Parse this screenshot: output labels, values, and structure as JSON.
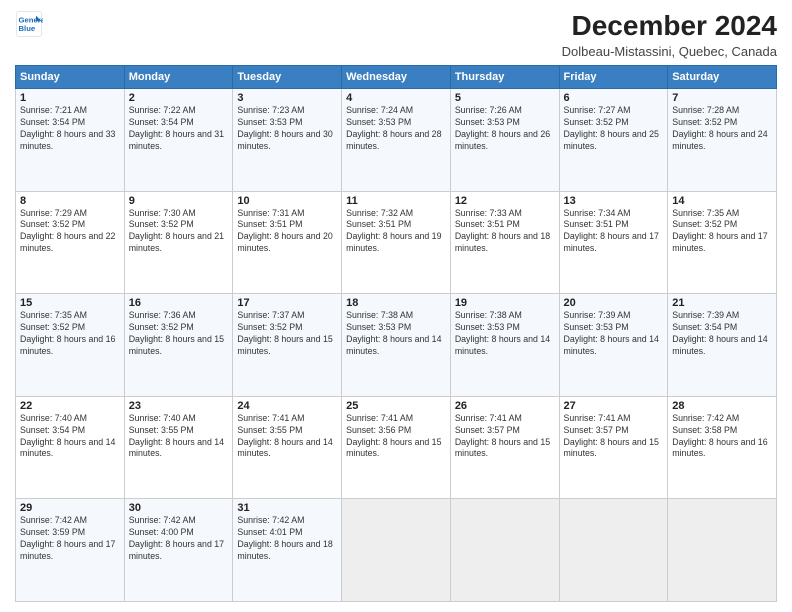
{
  "logo": {
    "line1": "General",
    "line2": "Blue"
  },
  "title": "December 2024",
  "subtitle": "Dolbeau-Mistassini, Quebec, Canada",
  "header_days": [
    "Sunday",
    "Monday",
    "Tuesday",
    "Wednesday",
    "Thursday",
    "Friday",
    "Saturday"
  ],
  "weeks": [
    [
      {
        "day": "1",
        "sunrise": "Sunrise: 7:21 AM",
        "sunset": "Sunset: 3:54 PM",
        "daylight": "Daylight: 8 hours and 33 minutes."
      },
      {
        "day": "2",
        "sunrise": "Sunrise: 7:22 AM",
        "sunset": "Sunset: 3:54 PM",
        "daylight": "Daylight: 8 hours and 31 minutes."
      },
      {
        "day": "3",
        "sunrise": "Sunrise: 7:23 AM",
        "sunset": "Sunset: 3:53 PM",
        "daylight": "Daylight: 8 hours and 30 minutes."
      },
      {
        "day": "4",
        "sunrise": "Sunrise: 7:24 AM",
        "sunset": "Sunset: 3:53 PM",
        "daylight": "Daylight: 8 hours and 28 minutes."
      },
      {
        "day": "5",
        "sunrise": "Sunrise: 7:26 AM",
        "sunset": "Sunset: 3:53 PM",
        "daylight": "Daylight: 8 hours and 26 minutes."
      },
      {
        "day": "6",
        "sunrise": "Sunrise: 7:27 AM",
        "sunset": "Sunset: 3:52 PM",
        "daylight": "Daylight: 8 hours and 25 minutes."
      },
      {
        "day": "7",
        "sunrise": "Sunrise: 7:28 AM",
        "sunset": "Sunset: 3:52 PM",
        "daylight": "Daylight: 8 hours and 24 minutes."
      }
    ],
    [
      {
        "day": "8",
        "sunrise": "Sunrise: 7:29 AM",
        "sunset": "Sunset: 3:52 PM",
        "daylight": "Daylight: 8 hours and 22 minutes."
      },
      {
        "day": "9",
        "sunrise": "Sunrise: 7:30 AM",
        "sunset": "Sunset: 3:52 PM",
        "daylight": "Daylight: 8 hours and 21 minutes."
      },
      {
        "day": "10",
        "sunrise": "Sunrise: 7:31 AM",
        "sunset": "Sunset: 3:51 PM",
        "daylight": "Daylight: 8 hours and 20 minutes."
      },
      {
        "day": "11",
        "sunrise": "Sunrise: 7:32 AM",
        "sunset": "Sunset: 3:51 PM",
        "daylight": "Daylight: 8 hours and 19 minutes."
      },
      {
        "day": "12",
        "sunrise": "Sunrise: 7:33 AM",
        "sunset": "Sunset: 3:51 PM",
        "daylight": "Daylight: 8 hours and 18 minutes."
      },
      {
        "day": "13",
        "sunrise": "Sunrise: 7:34 AM",
        "sunset": "Sunset: 3:51 PM",
        "daylight": "Daylight: 8 hours and 17 minutes."
      },
      {
        "day": "14",
        "sunrise": "Sunrise: 7:35 AM",
        "sunset": "Sunset: 3:52 PM",
        "daylight": "Daylight: 8 hours and 17 minutes."
      }
    ],
    [
      {
        "day": "15",
        "sunrise": "Sunrise: 7:35 AM",
        "sunset": "Sunset: 3:52 PM",
        "daylight": "Daylight: 8 hours and 16 minutes."
      },
      {
        "day": "16",
        "sunrise": "Sunrise: 7:36 AM",
        "sunset": "Sunset: 3:52 PM",
        "daylight": "Daylight: 8 hours and 15 minutes."
      },
      {
        "day": "17",
        "sunrise": "Sunrise: 7:37 AM",
        "sunset": "Sunset: 3:52 PM",
        "daylight": "Daylight: 8 hours and 15 minutes."
      },
      {
        "day": "18",
        "sunrise": "Sunrise: 7:38 AM",
        "sunset": "Sunset: 3:53 PM",
        "daylight": "Daylight: 8 hours and 14 minutes."
      },
      {
        "day": "19",
        "sunrise": "Sunrise: 7:38 AM",
        "sunset": "Sunset: 3:53 PM",
        "daylight": "Daylight: 8 hours and 14 minutes."
      },
      {
        "day": "20",
        "sunrise": "Sunrise: 7:39 AM",
        "sunset": "Sunset: 3:53 PM",
        "daylight": "Daylight: 8 hours and 14 minutes."
      },
      {
        "day": "21",
        "sunrise": "Sunrise: 7:39 AM",
        "sunset": "Sunset: 3:54 PM",
        "daylight": "Daylight: 8 hours and 14 minutes."
      }
    ],
    [
      {
        "day": "22",
        "sunrise": "Sunrise: 7:40 AM",
        "sunset": "Sunset: 3:54 PM",
        "daylight": "Daylight: 8 hours and 14 minutes."
      },
      {
        "day": "23",
        "sunrise": "Sunrise: 7:40 AM",
        "sunset": "Sunset: 3:55 PM",
        "daylight": "Daylight: 8 hours and 14 minutes."
      },
      {
        "day": "24",
        "sunrise": "Sunrise: 7:41 AM",
        "sunset": "Sunset: 3:55 PM",
        "daylight": "Daylight: 8 hours and 14 minutes."
      },
      {
        "day": "25",
        "sunrise": "Sunrise: 7:41 AM",
        "sunset": "Sunset: 3:56 PM",
        "daylight": "Daylight: 8 hours and 15 minutes."
      },
      {
        "day": "26",
        "sunrise": "Sunrise: 7:41 AM",
        "sunset": "Sunset: 3:57 PM",
        "daylight": "Daylight: 8 hours and 15 minutes."
      },
      {
        "day": "27",
        "sunrise": "Sunrise: 7:41 AM",
        "sunset": "Sunset: 3:57 PM",
        "daylight": "Daylight: 8 hours and 15 minutes."
      },
      {
        "day": "28",
        "sunrise": "Sunrise: 7:42 AM",
        "sunset": "Sunset: 3:58 PM",
        "daylight": "Daylight: 8 hours and 16 minutes."
      }
    ],
    [
      {
        "day": "29",
        "sunrise": "Sunrise: 7:42 AM",
        "sunset": "Sunset: 3:59 PM",
        "daylight": "Daylight: 8 hours and 17 minutes."
      },
      {
        "day": "30",
        "sunrise": "Sunrise: 7:42 AM",
        "sunset": "Sunset: 4:00 PM",
        "daylight": "Daylight: 8 hours and 17 minutes."
      },
      {
        "day": "31",
        "sunrise": "Sunrise: 7:42 AM",
        "sunset": "Sunset: 4:01 PM",
        "daylight": "Daylight: 8 hours and 18 minutes."
      },
      null,
      null,
      null,
      null
    ]
  ]
}
